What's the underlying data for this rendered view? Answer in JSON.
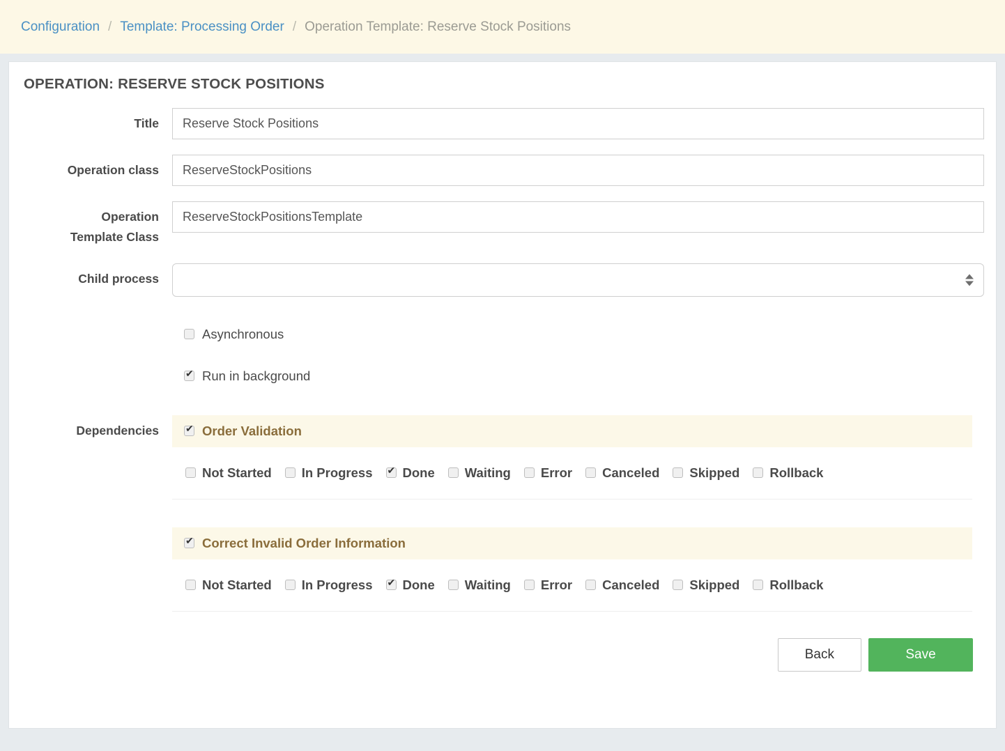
{
  "breadcrumb": {
    "separator": "/",
    "items": [
      {
        "label": "Configuration",
        "type": "link"
      },
      {
        "label": "Template: Processing Order",
        "type": "link"
      },
      {
        "label": "Operation Template: Reserve Stock Positions",
        "type": "current"
      }
    ]
  },
  "card": {
    "title": "OPERATION: RESERVE STOCK POSITIONS",
    "fields": {
      "title": {
        "label": "Title",
        "value": "Reserve Stock Positions",
        "placeholder": ""
      },
      "operation_class": {
        "label": "Operation class",
        "value": "ReserveStockPositions",
        "placeholder": ""
      },
      "operation_template_class": {
        "label_line1": "Operation",
        "label_line2": "Template Class",
        "value": "ReserveStockPositionsTemplate",
        "placeholder": ""
      },
      "child_process": {
        "label": "Child process",
        "selected": "",
        "options": []
      }
    },
    "flags": [
      {
        "label": "Asynchronous",
        "checked": false
      },
      {
        "label": "Run in background",
        "checked": true
      }
    ],
    "dependencies": {
      "label": "Dependencies",
      "items": [
        {
          "title": "Order Validation",
          "checked": true,
          "statuses": [
            {
              "label": "Not Started",
              "checked": false
            },
            {
              "label": "In Progress",
              "checked": false
            },
            {
              "label": "Done",
              "checked": true
            },
            {
              "label": "Waiting",
              "checked": false
            },
            {
              "label": "Error",
              "checked": false
            },
            {
              "label": "Canceled",
              "checked": false
            },
            {
              "label": "Skipped",
              "checked": false
            },
            {
              "label": "Rollback",
              "checked": false
            }
          ]
        },
        {
          "title": "Correct Invalid Order Information",
          "checked": true,
          "statuses": [
            {
              "label": "Not Started",
              "checked": false
            },
            {
              "label": "In Progress",
              "checked": false
            },
            {
              "label": "Done",
              "checked": true
            },
            {
              "label": "Waiting",
              "checked": false
            },
            {
              "label": "Error",
              "checked": false
            },
            {
              "label": "Canceled",
              "checked": false
            },
            {
              "label": "Skipped",
              "checked": false
            },
            {
              "label": "Rollback",
              "checked": false
            }
          ]
        }
      ]
    },
    "actions": {
      "back_label": "Back",
      "save_label": "Save"
    }
  },
  "colors": {
    "page_background": "#e7ebee",
    "breadcrumb_background": "#fdf8e6",
    "link": "#4a90c4",
    "dependency_header_background": "#fcf8e8",
    "dependency_title": "#8a6d3b",
    "save_button": "#52b45c"
  }
}
